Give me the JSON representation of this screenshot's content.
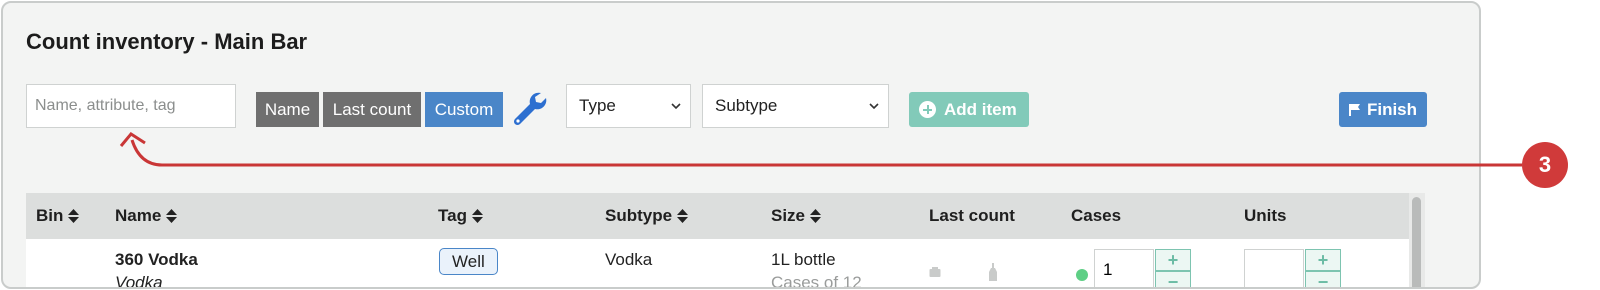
{
  "page": {
    "title": "Count inventory - Main Bar"
  },
  "toolbar": {
    "search_placeholder": "Name, attribute, tag",
    "sort_buttons": [
      "Name",
      "Last count",
      "Custom"
    ],
    "type_select": "Type",
    "subtype_select": "Subtype",
    "add_item": "Add item",
    "finish": "Finish"
  },
  "table": {
    "columns": [
      "Bin",
      "Name",
      "Tag",
      "Subtype",
      "Size",
      "Last count",
      "Cases",
      "Units"
    ],
    "rows": [
      {
        "name": "360 Vodka",
        "name_sub": "Vodka",
        "tag": "Well",
        "subtype": "Vodka",
        "size": "1L bottle",
        "size_sub": "Cases of 12",
        "cases_value": "1",
        "units_value": ""
      }
    ]
  },
  "annotation": {
    "number": "3"
  },
  "colors": {
    "primary": "#4a86c8",
    "gray_button": "#6f6f6f",
    "add_button": "#82cab9",
    "annotation": "#d03a3a",
    "status_dot": "#5ecf85"
  }
}
